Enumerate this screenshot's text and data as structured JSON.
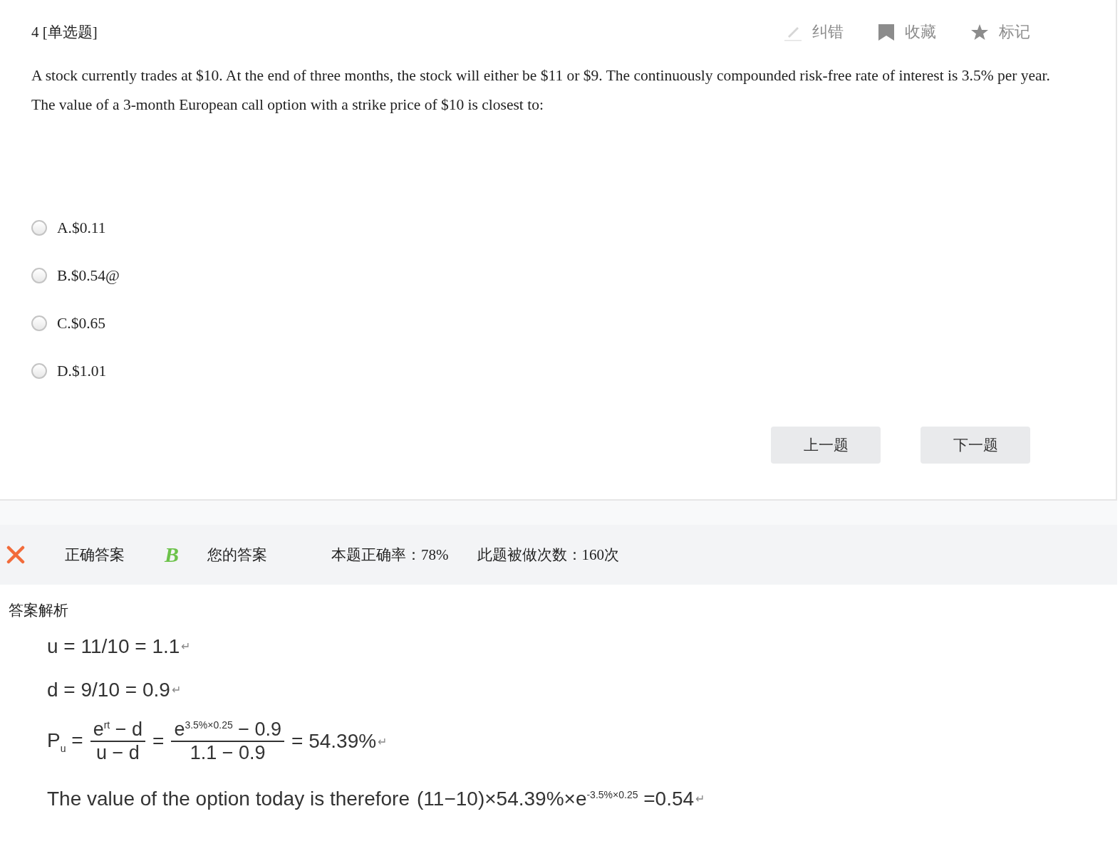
{
  "question": {
    "number": "4",
    "type": "[单选题]",
    "text": "A stock currently trades at $10. At the end of three months, the stock will either be $11 or $9. The continuously compounded risk-free rate of interest is 3.5% per year. The value of a 3-month European call option with a strike price of $10 is closest to:"
  },
  "actions": [
    {
      "kind": "edit",
      "label": "纠错"
    },
    {
      "kind": "bookmark",
      "label": "收藏"
    },
    {
      "kind": "star",
      "label": "标记"
    }
  ],
  "options": [
    {
      "label": "A.$0.11",
      "selected": false
    },
    {
      "label": "B.$0.54@",
      "selected": false
    },
    {
      "label": "C.$0.65",
      "selected": false
    },
    {
      "label": "D.$1.01",
      "selected": false
    }
  ],
  "nav_buttons": [
    "上一题",
    "下一题"
  ],
  "result": {
    "correct": false,
    "correct_answer_label": "正确答案",
    "correct_answer": "B",
    "your_answer_label": "您的答案",
    "accuracy": "本题正确率：78%",
    "attempts": "此题被做次数：160次"
  },
  "explanation": {
    "title": "答案解析",
    "lines": [
      [
        {
          "kind": "text",
          "text": "u = 11/10 = 1.1"
        },
        {
          "kind": "mark",
          "text": "↵"
        }
      ],
      [
        {
          "kind": "text",
          "text": "d = 9/10 = 0.9"
        },
        {
          "kind": "mark",
          "text": "↵"
        }
      ],
      [
        {
          "kind": "text",
          "text": "P$_{u}$ ="
        },
        {
          "kind": "fraction",
          "numerator": "e$^{rt}$ − d",
          "denominator": "u − d"
        },
        {
          "kind": "text",
          "text": "="
        },
        {
          "kind": "fraction",
          "numerator": "e$^{3.5%×0.25}$ − 0.9",
          "denominator": "1.1 − 0.9"
        },
        {
          "kind": "text",
          "text": "= 54.39%"
        },
        {
          "kind": "mark",
          "text": "↵"
        }
      ],
      [
        {
          "kind": "text",
          "text": "The value of the option today is therefore"
        },
        {
          "kind": "text",
          "text": "(11−10)×54.39%×e$^{-3.5%×0.25}$ =0.54"
        },
        {
          "kind": "mark",
          "text": "↵"
        }
      ]
    ]
  }
}
